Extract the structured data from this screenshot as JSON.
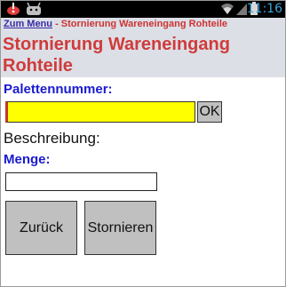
{
  "status_bar": {
    "time": "11:16",
    "icons": [
      "alert-icon",
      "android-icon",
      "wifi-icon",
      "signal-icon",
      "battery-icon"
    ],
    "time_color": "#3aa6d8"
  },
  "header": {
    "breadcrumb_link": "Zum Menu",
    "breadcrumb_separator": "-",
    "breadcrumb_current": "Stornierung Wareneingang Rohteile",
    "title": "Stornierung Wareneingang Rohteile",
    "background": "#dcdfe6",
    "title_color": "#d03b3b"
  },
  "form": {
    "pallet_label": "Palettennummer:",
    "pallet_value": "",
    "ok_label": "OK",
    "description_label": "Beschreibung:",
    "quantity_label": "Menge:",
    "quantity_value": ""
  },
  "buttons": {
    "back_label": "Zurück",
    "cancel_label": "Stornieren"
  },
  "colors": {
    "label_blue": "#1a1ad0",
    "pallet_field": "#ffff00",
    "button_gray": "#c0c0c0"
  }
}
